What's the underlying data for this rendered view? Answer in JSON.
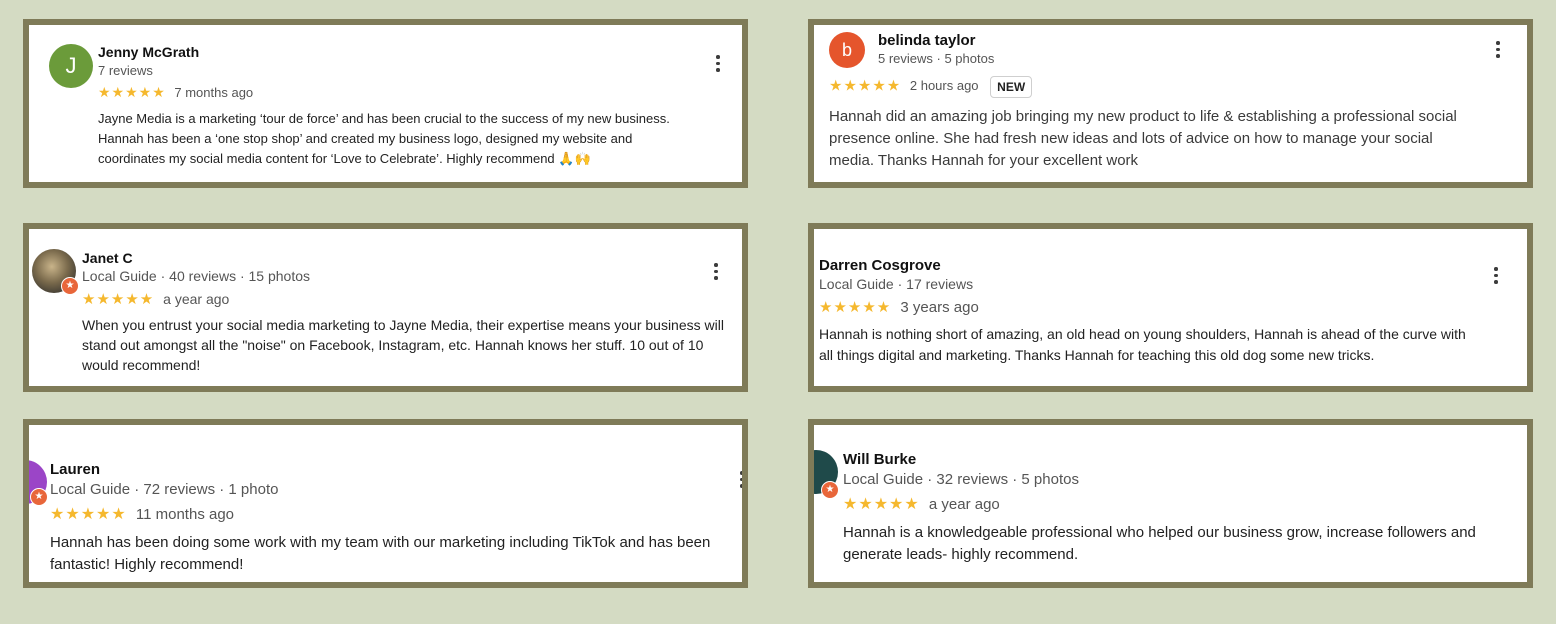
{
  "colors": {
    "background": "#d4dbc3",
    "frame": "#7f7b58",
    "star": "#f5b82e",
    "guide_badge": "#e8663a"
  },
  "reviews": [
    {
      "avatar_letter": "J",
      "avatar_color": "#6b9b3a",
      "name": "Jenny McGrath",
      "meta": "7 reviews",
      "stars": "★★★★★",
      "rating": 5,
      "ago": "7 months ago",
      "text_lines": [
        "Jayne Media is a marketing ‘tour de force’ and has been crucial to the success of my new business.",
        "Hannah has been a ‘one stop shop’ and created my business logo, designed my website and",
        "coordinates my social media content for ‘Love to Celebrate’. Highly recommend 🙏🙌"
      ]
    },
    {
      "avatar_letter": "b",
      "avatar_color": "#e5552c",
      "name": "belinda taylor",
      "meta": "5 reviews · 5 photos",
      "stars": "★★★★★",
      "rating": 5,
      "ago": "2 hours ago",
      "badge": "NEW",
      "text_lines": [
        "Hannah did an amazing job bringing my new product to life & establishing a professional social",
        "presence online. She had fresh new ideas and lots of advice on how to manage your social",
        "media. Thanks Hannah for your excellent work"
      ]
    },
    {
      "name": "Janet C",
      "meta": "Local Guide · 40 reviews · 15 photos",
      "stars": "★★★★★",
      "rating": 5,
      "ago": "a year ago",
      "text_lines": [
        "When you entrust your social media marketing to Jayne Media, their expertise means your business will",
        "stand out amongst all the \"noise\" on Facebook, Instagram, etc. Hannah knows her stuff. 10 out of 10",
        "would recommend!"
      ]
    },
    {
      "name": "Darren Cosgrove",
      "meta": "Local Guide · 17 reviews",
      "stars": "★★★★★",
      "rating": 5,
      "ago": "3 years ago",
      "text_lines": [
        "Hannah is nothing short of amazing, an old head on young shoulders, Hannah is ahead of the curve with",
        "all things digital and marketing. Thanks Hannah for teaching this old dog some new tricks."
      ]
    },
    {
      "name": "Lauren",
      "meta": "Local Guide · 72 reviews · 1 photo",
      "stars": "★★★★★",
      "rating": 5,
      "ago": "11 months ago",
      "text_lines": [
        "Hannah has been doing some work with my team with our marketing including TikTok and has been",
        "fantastic! Highly recommend!"
      ]
    },
    {
      "name": "Will Burke",
      "meta": "Local Guide · 32 reviews · 5 photos",
      "stars": "★★★★★",
      "rating": 5,
      "ago": "a year ago",
      "text_lines": [
        "Hannah is a knowledgeable professional who helped our business grow, increase followers and",
        "generate leads- highly recommend."
      ]
    }
  ]
}
